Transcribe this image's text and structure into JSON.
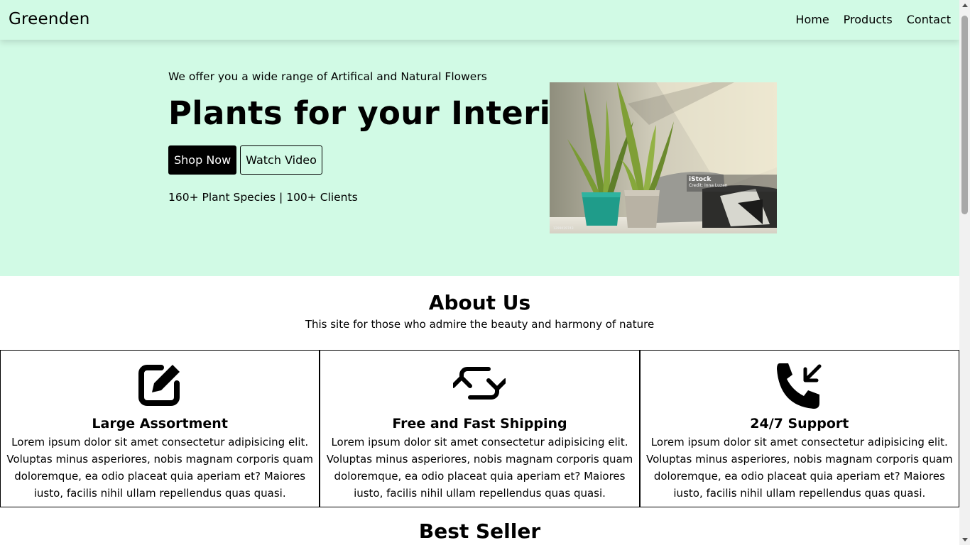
{
  "navbar": {
    "brand": "Greenden",
    "links": [
      "Home",
      "Products",
      "Contact"
    ]
  },
  "hero": {
    "tagline": "We offer you a wide range of Artifical and Natural Flowers",
    "title": "Plants for your Interior",
    "primary_button": "Shop Now",
    "secondary_button": "Watch Video",
    "stats": "160+ Plant Species | 100+ Clients",
    "image": {
      "watermark": "iStock",
      "credit": "Credit: Inna Luzan",
      "id": "1299029743"
    }
  },
  "about": {
    "title": "About Us",
    "subtitle": "This site for those who admire the beauty and harmony of nature"
  },
  "features": [
    {
      "icon": "edit-icon",
      "title": "Large Assortment",
      "text": "Lorem ipsum dolor sit amet consectetur adipisicing elit. Voluptas minus asperiores, nobis magnam corporis quam doloremque, ea odio placeat quia aperiam et? Maiores iusto, facilis nihil ullam repellendus quas quasi."
    },
    {
      "icon": "refresh-icon",
      "title": "Free and Fast Shipping",
      "text": "Lorem ipsum dolor sit amet consectetur adipisicing elit. Voluptas minus asperiores, nobis magnam corporis quam doloremque, ea odio placeat quia aperiam et? Maiores iusto, facilis nihil ullam repellendus quas quasi."
    },
    {
      "icon": "phone-incoming-icon",
      "title": "24/7 Support",
      "text": "Lorem ipsum dolor sit amet consectetur adipisicing elit. Voluptas minus asperiores, nobis magnam corporis quam doloremque, ea odio placeat quia aperiam et? Maiores iusto, facilis nihil ullam repellendus quas quasi."
    }
  ],
  "best_seller": {
    "title": "Best Seller"
  },
  "colors": {
    "hero_background": "#d1fae5",
    "primary_button": "#000000",
    "text": "#000000"
  }
}
